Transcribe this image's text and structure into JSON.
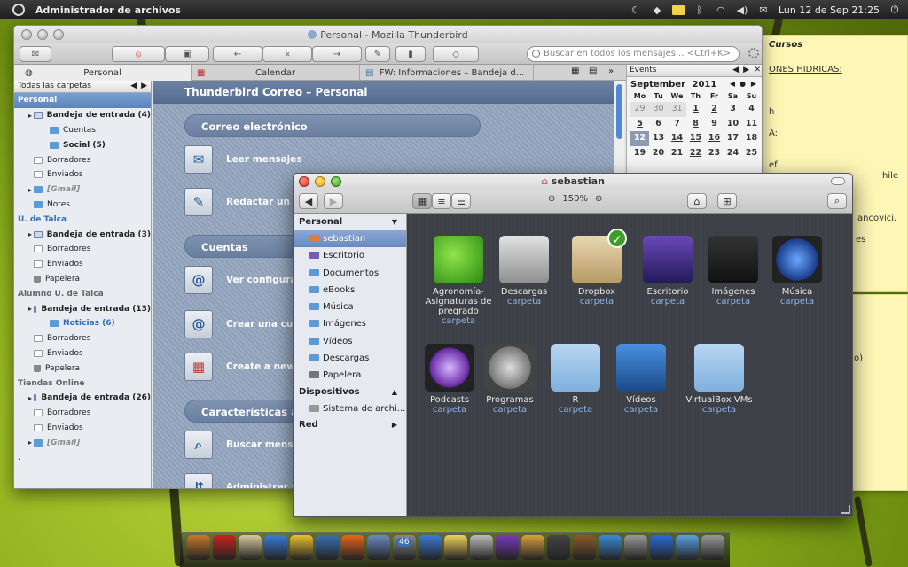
{
  "top_panel": {
    "app_title": "Administrador de archivos",
    "datetime": "Lun 12 de Sep 21:25"
  },
  "sticky_notes": {
    "note1_title": "Cursos",
    "note1_lines": [
      "ONES HIDRICAS:",
      "h",
      "A:",
      "ef",
      "hile",
      "ancovici.",
      "es"
    ],
    "note2_lines": [
      "o)"
    ]
  },
  "thunderbird": {
    "window_title": "Personal - Mozilla Thunderbird",
    "search_placeholder": "Buscar en todos los mensajes... <Ctrl+K>",
    "tabs": [
      "Personal",
      "Calendar",
      "FW: Informaciones – Bandeja d..."
    ],
    "folder_header": "Todas las carpetas",
    "folders": [
      {
        "label": "Personal",
        "kind": "account-selected",
        "indent": 0
      },
      {
        "label": "Bandeja de entrada (4)",
        "kind": "inbox-bold",
        "indent": 1
      },
      {
        "label": "Cuentas",
        "kind": "folder",
        "indent": 2
      },
      {
        "label": "Social (5)",
        "kind": "folder-bold",
        "indent": 2
      },
      {
        "label": "Borradores",
        "kind": "doc",
        "indent": 1
      },
      {
        "label": "Enviados",
        "kind": "doc",
        "indent": 1
      },
      {
        "label": "[Gmail]",
        "kind": "gmail",
        "indent": 1
      },
      {
        "label": "Notes",
        "kind": "folder",
        "indent": 1
      },
      {
        "label": "U. de Talca",
        "kind": "account",
        "indent": 0
      },
      {
        "label": "Bandeja de entrada (3)",
        "kind": "inbox-bold",
        "indent": 1
      },
      {
        "label": "Borradores",
        "kind": "doc",
        "indent": 1
      },
      {
        "label": "Enviados",
        "kind": "doc",
        "indent": 1
      },
      {
        "label": "Papelera",
        "kind": "trash",
        "indent": 1
      },
      {
        "label": "Alumno U. de Talca",
        "kind": "account-gray",
        "indent": 0
      },
      {
        "label": "Bandeja de entrada (13)",
        "kind": "inbox-bold",
        "indent": 1
      },
      {
        "label": "Noticias (6)",
        "kind": "folder-blue",
        "indent": 2
      },
      {
        "label": "Borradores",
        "kind": "doc",
        "indent": 1
      },
      {
        "label": "Enviados",
        "kind": "doc",
        "indent": 1
      },
      {
        "label": "Papelera",
        "kind": "trash",
        "indent": 1
      },
      {
        "label": "Tiendas Online",
        "kind": "account-gray",
        "indent": 0
      },
      {
        "label": "Bandeja de entrada (26)",
        "kind": "inbox-bold",
        "indent": 1
      },
      {
        "label": "Borradores",
        "kind": "doc",
        "indent": 1
      },
      {
        "label": "Enviados",
        "kind": "doc",
        "indent": 1
      },
      {
        "label": "[Gmail]",
        "kind": "gmail",
        "indent": 1
      },
      {
        "label": ".",
        "kind": "plain",
        "indent": 0
      }
    ],
    "main_header": "Thunderbird Correo – Personal",
    "sections": [
      "Correo electrónico",
      "Cuentas",
      "Características ava"
    ],
    "actions": [
      "Leer mensajes",
      "Redactar un n",
      "Ver configura",
      "Crear una cue",
      "Create a new",
      "Buscar mensa",
      "Administrar f"
    ],
    "events": {
      "title": "Events",
      "month": "September",
      "year": "2011",
      "day_names": [
        "Mo",
        "Tu",
        "We",
        "Th",
        "Fr",
        "Sa",
        "Su"
      ],
      "weeks": [
        [
          {
            "d": "29",
            "c": "om"
          },
          {
            "d": "30",
            "c": "om"
          },
          {
            "d": "31",
            "c": "om"
          },
          {
            "d": "1",
            "c": "d ul"
          },
          {
            "d": "2",
            "c": "d ul"
          },
          {
            "d": "3",
            "c": "d"
          },
          {
            "d": "4",
            "c": "d"
          }
        ],
        [
          {
            "d": "5",
            "c": "d ul"
          },
          {
            "d": "6",
            "c": "d"
          },
          {
            "d": "7",
            "c": "d"
          },
          {
            "d": "8",
            "c": "d ul"
          },
          {
            "d": "9",
            "c": "d"
          },
          {
            "d": "10",
            "c": "d"
          },
          {
            "d": "11",
            "c": "d"
          }
        ],
        [
          {
            "d": "12",
            "c": "d today"
          },
          {
            "d": "13",
            "c": "d"
          },
          {
            "d": "14",
            "c": "d ul"
          },
          {
            "d": "15",
            "c": "d ul"
          },
          {
            "d": "16",
            "c": "d ul"
          },
          {
            "d": "17",
            "c": "d"
          },
          {
            "d": "18",
            "c": "d"
          }
        ],
        [
          {
            "d": "19",
            "c": "d"
          },
          {
            "d": "20",
            "c": "d"
          },
          {
            "d": "21",
            "c": "d"
          },
          {
            "d": "22",
            "c": "d ul"
          },
          {
            "d": "23",
            "c": "d"
          },
          {
            "d": "24",
            "c": "d"
          },
          {
            "d": "25",
            "c": "d"
          }
        ]
      ]
    }
  },
  "file_manager": {
    "window_title": "sebastian",
    "zoom_label": "150%",
    "sidebar": [
      {
        "label": "Personal",
        "kind": "head",
        "tri": "▼"
      },
      {
        "label": "sebastian",
        "kind": "sel"
      },
      {
        "label": "Escritorio",
        "kind": "item"
      },
      {
        "label": "Documentos",
        "kind": "item"
      },
      {
        "label": "eBooks",
        "kind": "item"
      },
      {
        "label": "Música",
        "kind": "item"
      },
      {
        "label": "Imágenes",
        "kind": "item"
      },
      {
        "label": "Vídeos",
        "kind": "item"
      },
      {
        "label": "Descargas",
        "kind": "item"
      },
      {
        "label": "Papelera",
        "kind": "item"
      },
      {
        "label": "Dispositivos",
        "kind": "head",
        "tri": "▲"
      },
      {
        "label": "Sistema de archi...",
        "kind": "item"
      },
      {
        "label": "Red",
        "kind": "head",
        "tri": "▶"
      }
    ],
    "items": [
      {
        "name": "Agronomía-Asignaturas de pregrado",
        "type": "carpeta",
        "icon": "leaf"
      },
      {
        "name": "Descargas",
        "type": "carpeta",
        "icon": "drive"
      },
      {
        "name": "Dropbox",
        "type": "carpeta",
        "icon": "dropbox"
      },
      {
        "name": "Escritorio",
        "type": "carpeta",
        "icon": "desk"
      },
      {
        "name": "Imágenes",
        "type": "carpeta",
        "icon": "cam"
      },
      {
        "name": "Música",
        "type": "carpeta",
        "icon": "music"
      },
      {
        "name": "Podcasts",
        "type": "carpeta",
        "icon": "pod"
      },
      {
        "name": "Programas",
        "type": "carpeta",
        "icon": "gear"
      },
      {
        "name": "R",
        "type": "carpeta",
        "icon": "folder"
      },
      {
        "name": "Vídeos",
        "type": "carpeta",
        "icon": "film"
      },
      {
        "name": "VirtualBox VMs",
        "type": "carpeta",
        "icon": "folder"
      }
    ]
  },
  "dock_badge": "46"
}
